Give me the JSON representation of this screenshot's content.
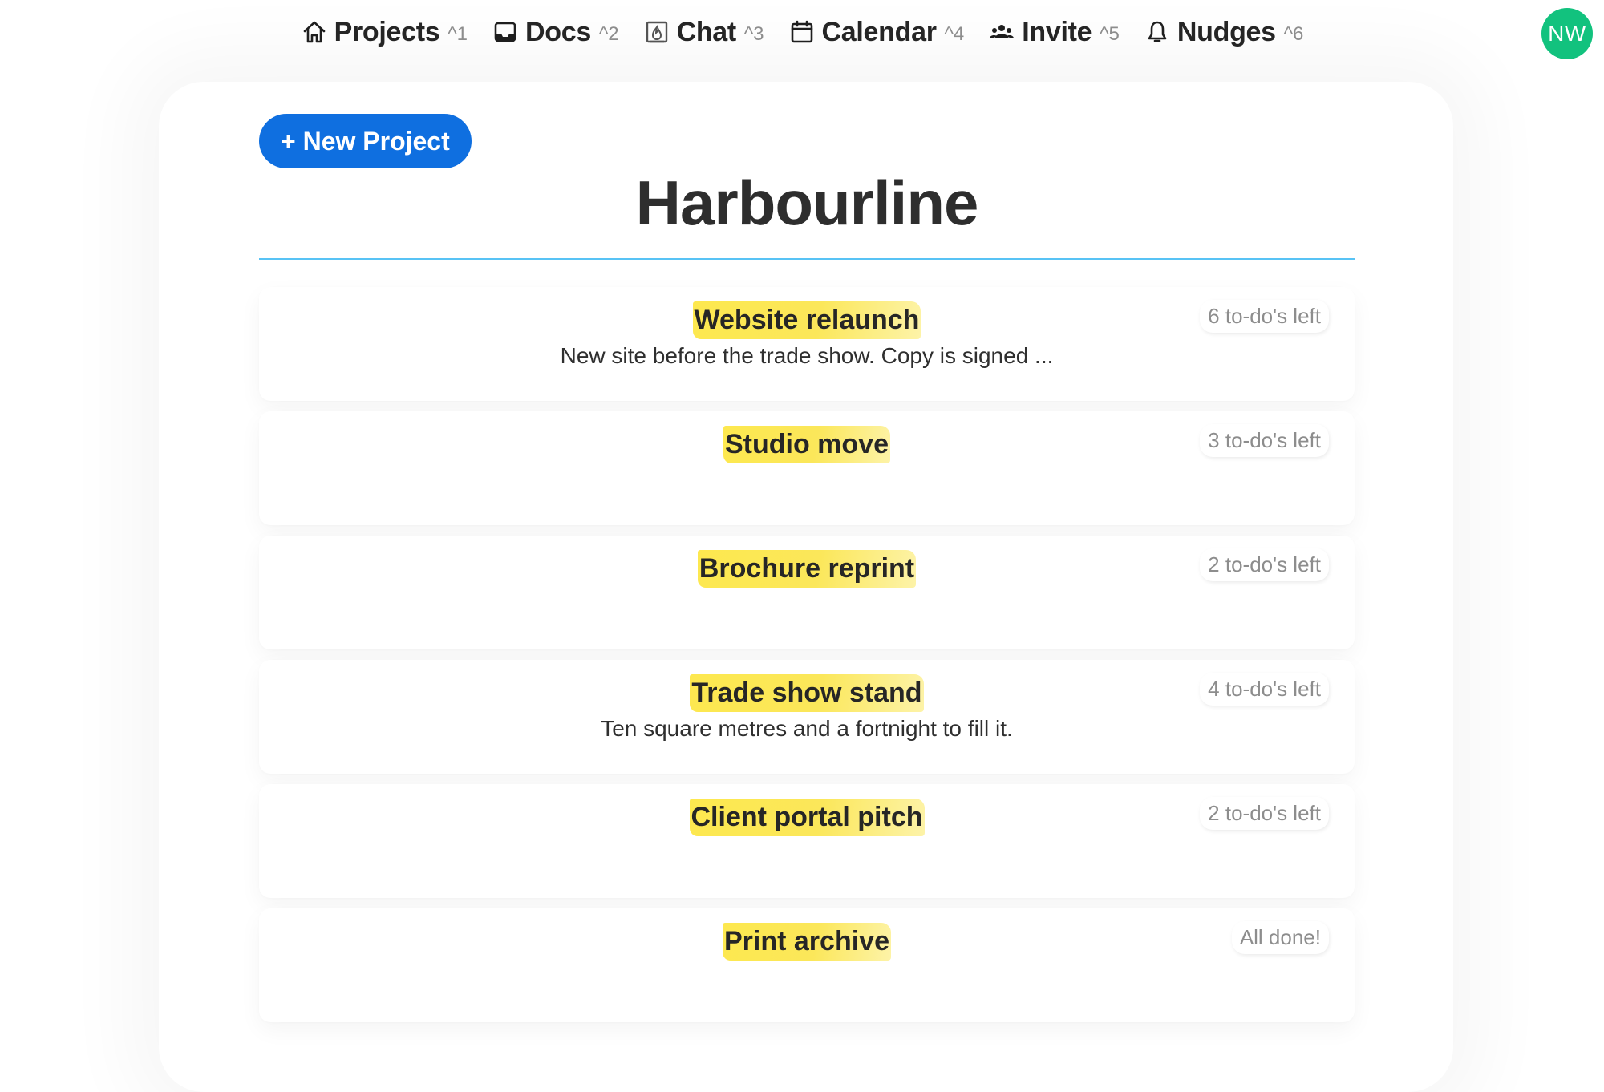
{
  "nav": {
    "items": [
      {
        "label": "Projects",
        "shortcut": "^1",
        "icon": "home-icon"
      },
      {
        "label": "Docs",
        "shortcut": "^2",
        "icon": "inbox-icon"
      },
      {
        "label": "Chat",
        "shortcut": "^3",
        "icon": "campfire-icon"
      },
      {
        "label": "Calendar",
        "shortcut": "^4",
        "icon": "calendar-icon"
      },
      {
        "label": "Invite",
        "shortcut": "^5",
        "icon": "people-icon"
      },
      {
        "label": "Nudges",
        "shortcut": "^6",
        "icon": "bell-icon"
      }
    ],
    "avatar_initials": "NW",
    "avatar_color": "#12c27e"
  },
  "main": {
    "new_project_label": "+ New Project",
    "title": "Harbourline",
    "accent_color": "#0f6fe0",
    "divider_color": "#58c3f5",
    "highlight_color": "#fde84f",
    "projects": [
      {
        "name": "Website relaunch",
        "description": "New site before the trade show. Copy is signed ...",
        "status": "6 to-do's left"
      },
      {
        "name": "Studio move",
        "description": "",
        "status": "3 to-do's left"
      },
      {
        "name": "Brochure reprint",
        "description": "",
        "status": "2 to-do's left"
      },
      {
        "name": "Trade show stand",
        "description": "Ten square metres and a fortnight to fill it.",
        "status": "4 to-do's left"
      },
      {
        "name": "Client portal pitch",
        "description": "",
        "status": "2 to-do's left"
      },
      {
        "name": "Print archive",
        "description": "",
        "status": "All done!"
      }
    ]
  }
}
